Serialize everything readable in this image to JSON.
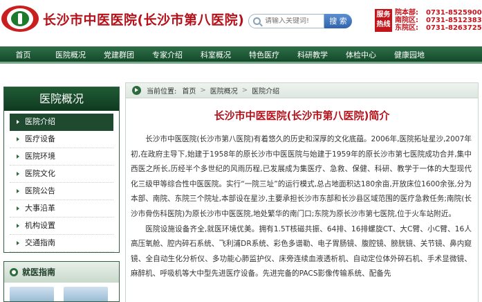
{
  "header": {
    "site_title": "长沙市中医医院(长沙市第八医院)",
    "logo_icon": "hospital-logo-icon",
    "search_placeholder": "请输入关键词!",
    "search_button": "搜 索",
    "hotline_badge": "服务热线",
    "phones": [
      {
        "label": "院本部:",
        "number": "0731-85259000"
      },
      {
        "label": "南院区:",
        "number": "0731-85123831"
      },
      {
        "label": "东院区:",
        "number": "0731-82637257"
      }
    ]
  },
  "nav": {
    "items": [
      "首页",
      "医院概况",
      "党建群团",
      "专家介绍",
      "科室概况",
      "特色医疗",
      "科研教学",
      "体检中心",
      "健康园地"
    ]
  },
  "sidebar": {
    "title": "医院概况",
    "items": [
      {
        "label": "医院介绍",
        "active": true
      },
      {
        "label": "医疗设备",
        "active": false
      },
      {
        "label": "医院环境",
        "active": false
      },
      {
        "label": "医院文化",
        "active": false
      },
      {
        "label": "医院公告",
        "active": false
      },
      {
        "label": "大事沿革",
        "active": false
      },
      {
        "label": "机构设置",
        "active": false
      },
      {
        "label": "交通指南",
        "active": false
      }
    ]
  },
  "guide": {
    "title": "就医指南"
  },
  "breadcrumb": {
    "prefix": "当前位置:",
    "items": [
      "首页",
      "医院概况",
      "医院介绍"
    ]
  },
  "article": {
    "title": "长沙市中医医院(长沙市第八医院)简介",
    "paragraphs": [
      "长沙市中医医院(长沙市第八医院)有着悠久的历史和深厚的文化底蕴。2006年,医院拓址星沙,2007年初,在政府主导下,始建于1958年的原长沙市中医医院与始建于1959年的原长沙市第七医院成功合并,集中西医之所长,历经半个多世纪的风雨历程,已发展成为集医疗、急救、保健、科研、教学于一体的大型现代化三级甲等综合性中医医院。实行“一院三址”的运行模式,总占地面积达180余亩,开放床位1600余张,分为本部、南院、东院三个院址,本部设在星沙,主要承担长沙市东部和长沙县区域范围的医疗急救任务;南院(长沙市骨伤科医院)为原长沙市中医医院,地处繁华的南门口;东院为原长沙市第七医院,位于火车站附近。",
      "医院设施设备齐全,就医环境优美。拥有1.5T核磁共振、64排、16排螺旋CT、大C臂、小C臂、16人高压氧舱、腔内碎石系统、飞利浦DR系统、彩色多谱勒、电子胃肠镜、腹腔镜、膀胱镜、关节镜、鼻内窥镜、全自动生化分析仪、多功能心肺监护仪、床旁连续血液透析机、自动定位体外碎石机、手术显微镜、麻醉机、呼吸机等大中型先进医疗设备。先进完备的PACS影像传输系统、配备先"
    ]
  },
  "colors": {
    "brand_red": "#b5111a",
    "nav_green": "#134a2a",
    "title_red": "#b5111a"
  }
}
